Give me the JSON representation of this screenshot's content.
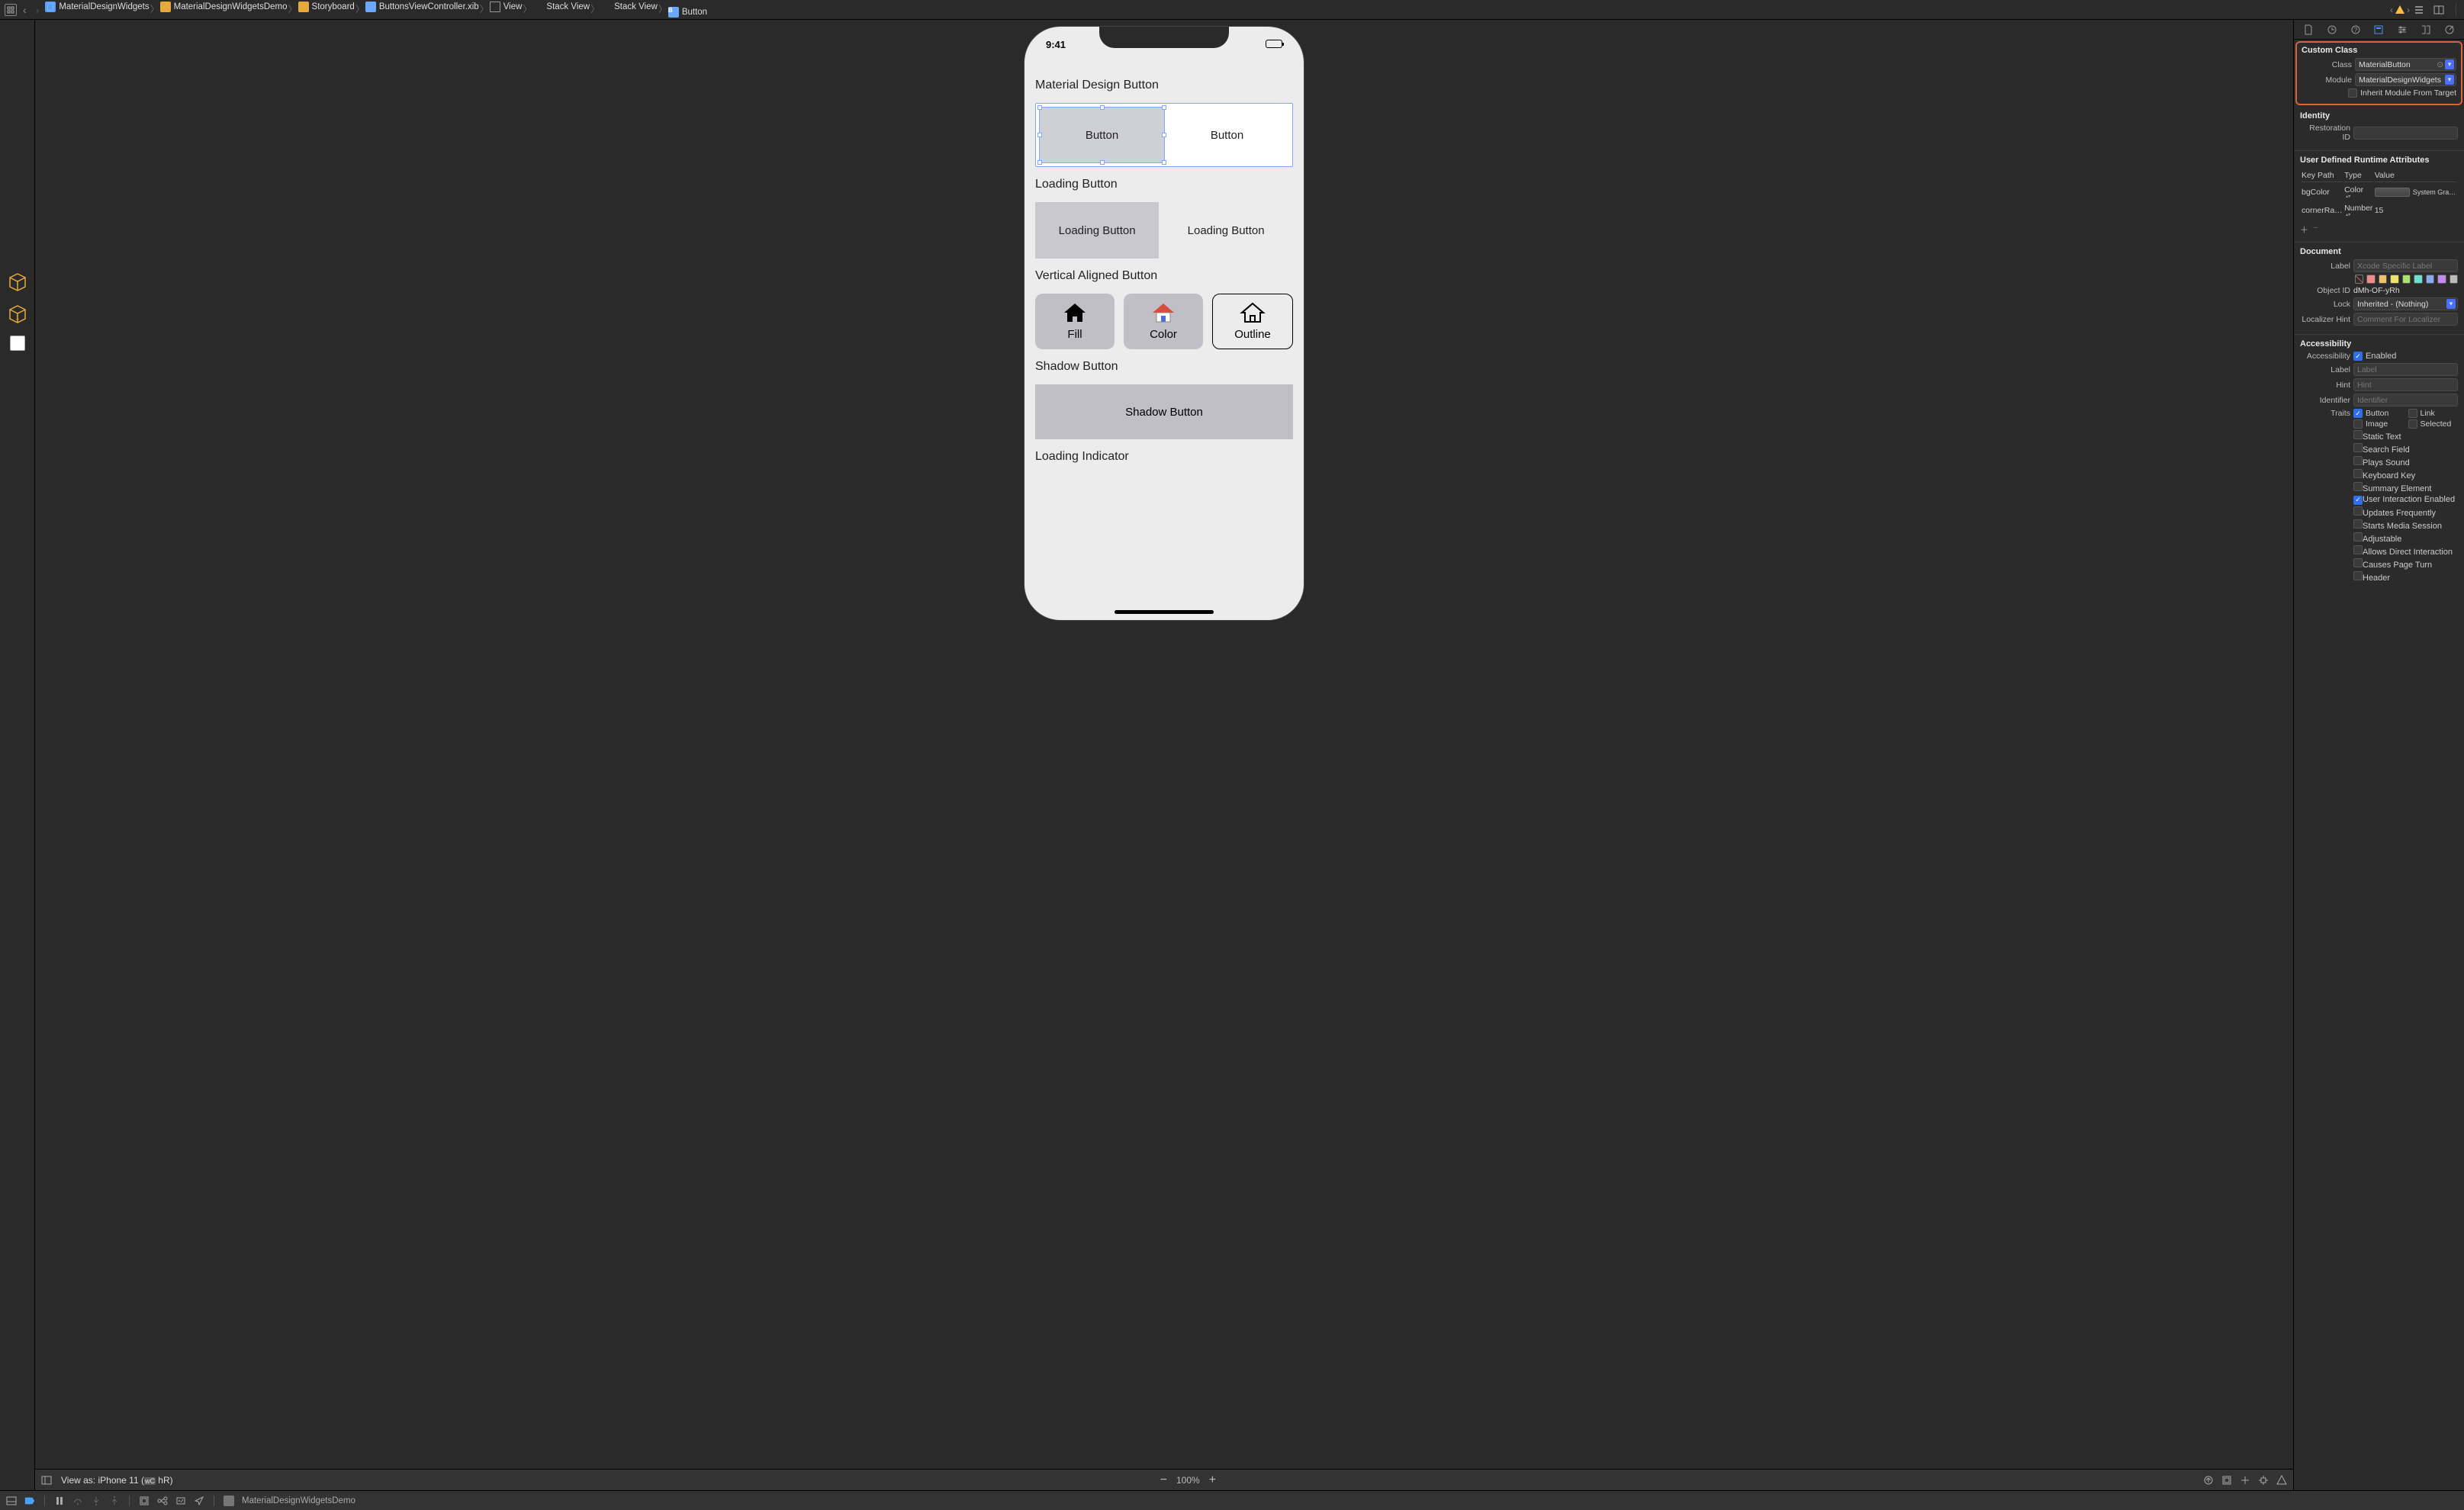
{
  "breadcrumb": {
    "items": [
      {
        "icon": "file",
        "label": "MaterialDesignWidgets"
      },
      {
        "icon": "folder",
        "label": "MaterialDesignWidgetsDemo"
      },
      {
        "icon": "folder",
        "label": "Storyboard"
      },
      {
        "icon": "xib",
        "label": "ButtonsViewController.xib"
      },
      {
        "icon": "view",
        "label": "View"
      },
      {
        "icon": "stack-v",
        "label": "Stack View"
      },
      {
        "icon": "stack-h",
        "label": "Stack View"
      },
      {
        "icon": "button",
        "label": "Button"
      }
    ],
    "warning_count": "",
    "nav_back_enabled": true,
    "nav_fwd_enabled": false
  },
  "phone": {
    "time": "9:41",
    "sections": {
      "material_button": "Material Design Button",
      "btn1": "Button",
      "btn2": "Button",
      "loading_button_title": "Loading Button",
      "loading_btn1": "Loading Button",
      "loading_btn2": "Loading Button",
      "vertical_title": "Vertical Aligned Button",
      "vbtn_fill": "Fill",
      "vbtn_color": "Color",
      "vbtn_outline": "Outline",
      "shadow_title": "Shadow Button",
      "shadow_btn": "Shadow Button",
      "loading_indicator_title": "Loading Indicator"
    }
  },
  "canvas_bottom": {
    "view_as": "View as: iPhone 11 (",
    "wc": "wC",
    "hr": " hR",
    "close_paren": ")",
    "zoom": "100%"
  },
  "inspector": {
    "custom_class": {
      "header": "Custom Class",
      "class_label": "Class",
      "class_value": "MaterialButton",
      "module_label": "Module",
      "module_value": "MaterialDesignWidgets",
      "inherit_label": "Inherit Module From Target"
    },
    "identity": {
      "header": "Identity",
      "restoration_label": "Restoration ID"
    },
    "runtime": {
      "header": "User Defined Runtime Attributes",
      "col_keypath": "Key Path",
      "col_type": "Type",
      "col_value": "Value",
      "rows": [
        {
          "keypath": "bgColor",
          "type": "Color",
          "value": "System Gra…"
        },
        {
          "keypath": "cornerRa…",
          "type": "Number",
          "value": "15"
        }
      ]
    },
    "document": {
      "header": "Document",
      "label_label": "Label",
      "label_placeholder": "Xcode Specific Label",
      "swatches": [
        "#00000000",
        "#f08a8a",
        "#f0c169",
        "#f0e269",
        "#a9e269",
        "#69e2d2",
        "#8aaaf0",
        "#c28af0",
        "#bbbbbb"
      ],
      "objectid_label": "Object ID",
      "objectid_value": "dMh-OF-yRh",
      "lock_label": "Lock",
      "lock_value": "Inherited - (Nothing)",
      "localizer_label": "Localizer Hint",
      "localizer_placeholder": "Comment For Localizer"
    },
    "accessibility": {
      "header": "Accessibility",
      "accessibility_label": "Accessibility",
      "enabled_label": "Enabled",
      "label_label": "Label",
      "label_placeholder": "Label",
      "hint_label": "Hint",
      "hint_placeholder": "Hint",
      "identifier_label": "Identifier",
      "identifier_placeholder": "Identifier",
      "traits_label": "Traits",
      "traits_two_col": [
        {
          "name": "Button",
          "on": true
        },
        {
          "name": "Link",
          "on": false
        },
        {
          "name": "Image",
          "on": false
        },
        {
          "name": "Selected",
          "on": false
        }
      ],
      "traits_one_col": [
        {
          "name": "Static Text",
          "on": false
        },
        {
          "name": "Search Field",
          "on": false
        },
        {
          "name": "Plays Sound",
          "on": false
        },
        {
          "name": "Keyboard Key",
          "on": false
        },
        {
          "name": "Summary Element",
          "on": false
        },
        {
          "name": "User Interaction Enabled",
          "on": true
        },
        {
          "name": "Updates Frequently",
          "on": false
        },
        {
          "name": "Starts Media Session",
          "on": false
        },
        {
          "name": "Adjustable",
          "on": false
        },
        {
          "name": "Allows Direct Interaction",
          "on": false
        },
        {
          "name": "Causes Page Turn",
          "on": false
        },
        {
          "name": "Header",
          "on": false
        }
      ]
    }
  },
  "debugbar": {
    "target": "MaterialDesignWidgetsDemo"
  }
}
